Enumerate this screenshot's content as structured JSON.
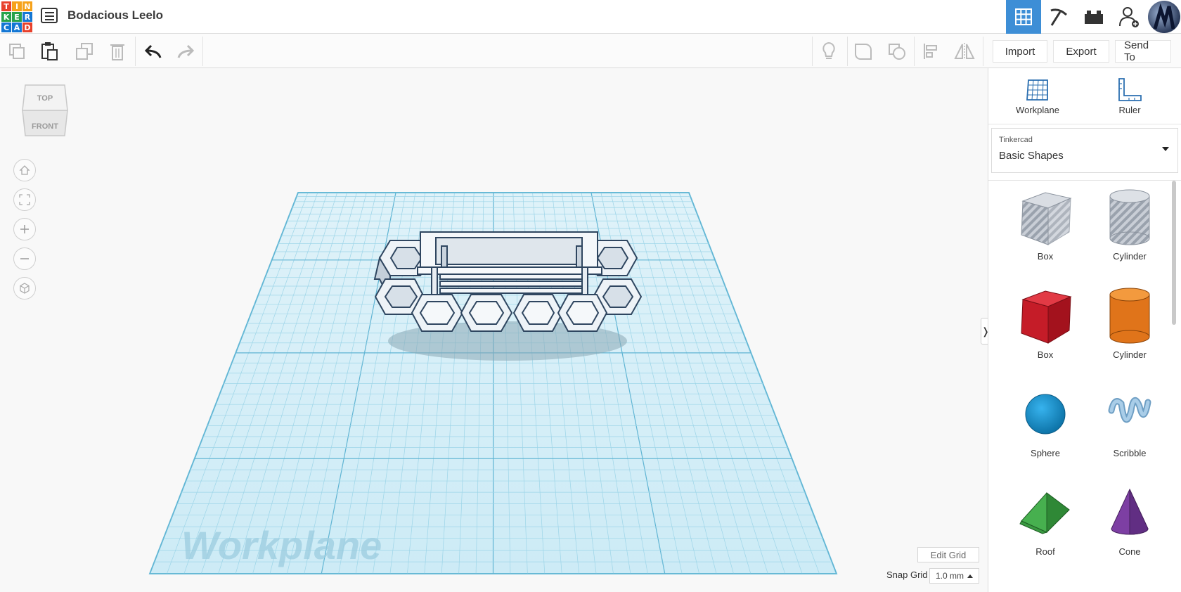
{
  "header": {
    "logo_letters": [
      "T",
      "I",
      "N",
      "K",
      "E",
      "R",
      "C",
      "A",
      "D"
    ],
    "logo_colors": [
      "#e8412c",
      "#f6a21b",
      "#f6a21b",
      "#27a24a",
      "#27a24a",
      "#1477d4",
      "#1477d4",
      "#1477d4",
      "#e8412c"
    ],
    "project_title": "Bodacious Leelo",
    "modes": [
      {
        "name": "3d-design",
        "icon": "grid-icon",
        "active": true
      },
      {
        "name": "codeblocks",
        "icon": "pickaxe-icon",
        "active": false
      },
      {
        "name": "bricks",
        "icon": "brick-icon",
        "active": false
      },
      {
        "name": "invite",
        "icon": "add-user-icon",
        "active": false
      }
    ]
  },
  "toolbar": {
    "copy_icon": "copy-icon",
    "paste_icon": "paste-icon",
    "duplicate_icon": "duplicate-icon",
    "delete_icon": "trash-icon",
    "undo_icon": "undo-icon",
    "redo_icon": "redo-icon",
    "notes_icon": "lightbulb-icon",
    "align_icon": "align-icon",
    "mirror_icon": "mirror-icon",
    "import_label": "Import",
    "export_label": "Export",
    "sendto_label": "Send To"
  },
  "viewport": {
    "viewcube_top": "TOP",
    "viewcube_front": "FRONT",
    "workplane_label": "Workplane",
    "edit_grid_label": "Edit Grid",
    "snap_grid_label": "Snap Grid",
    "snap_grid_value": "1.0 mm",
    "collapse_label": "❭"
  },
  "panel": {
    "workplane_label": "Workplane",
    "ruler_label": "Ruler",
    "library_small": "Tinkercad",
    "library_value": "Basic Shapes",
    "shapes": [
      {
        "label": "Box",
        "kind": "box-hole"
      },
      {
        "label": "Cylinder",
        "kind": "cylinder-hole"
      },
      {
        "label": "Box",
        "kind": "box-solid"
      },
      {
        "label": "Cylinder",
        "kind": "cylinder-solid"
      },
      {
        "label": "Sphere",
        "kind": "sphere"
      },
      {
        "label": "Scribble",
        "kind": "scribble"
      },
      {
        "label": "Roof",
        "kind": "roof"
      },
      {
        "label": "Cone",
        "kind": "cone"
      }
    ],
    "colors": {
      "box_red": "#c81e2b",
      "cylinder_orange": "#e77a1a",
      "sphere_blue": "#1b95d4",
      "roof_green": "#3aa442",
      "cone_purple": "#7b3fa0"
    }
  }
}
